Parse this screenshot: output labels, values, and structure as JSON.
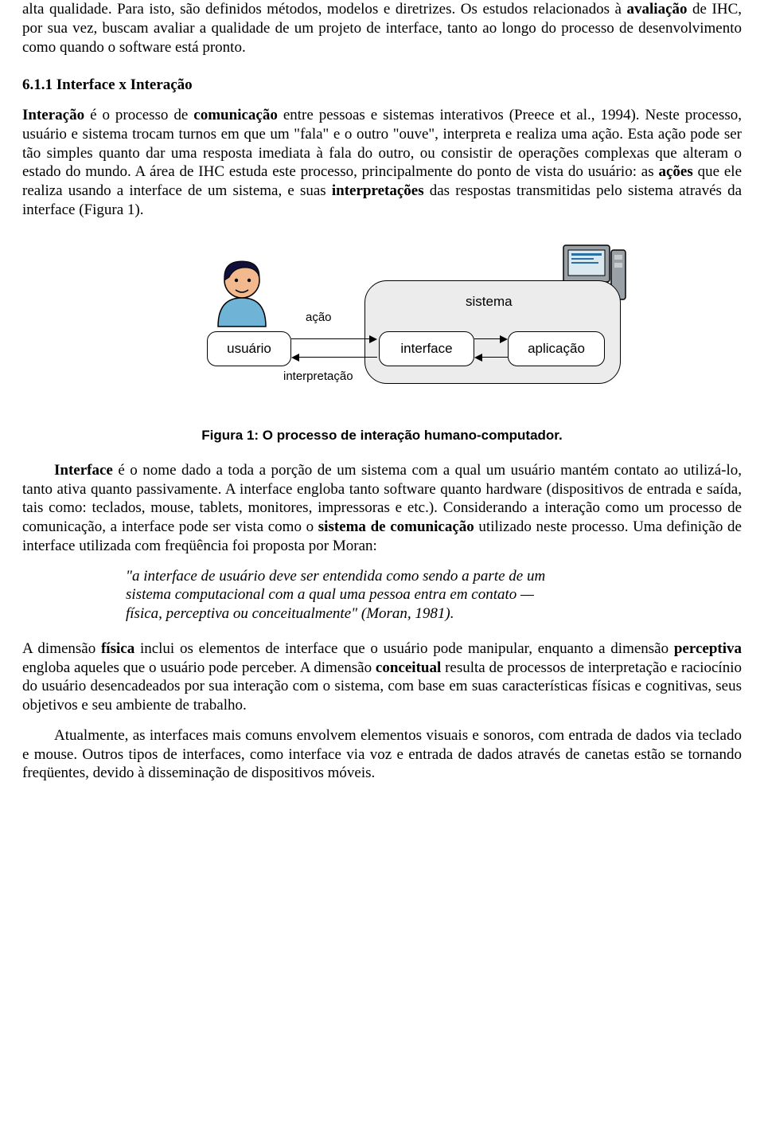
{
  "paragraphs": {
    "p1a": "alta qualidade. Para isto, são definidos métodos, modelos e diretrizes. Os estudos relacionados à ",
    "p1b": "avaliação",
    "p1c": " de IHC, por sua vez, buscam avaliar a qualidade de um projeto de interface, tanto ao longo do processo de desenvolvimento como quando o software está pronto.",
    "h1": "6.1.1 Interface x Interação",
    "p2a": "Interação",
    "p2b": " é o processo de ",
    "p2c": "comunicação",
    "p2d": " entre pessoas e sistemas interativos (Preece et al., 1994). Neste processo, usuário e sistema trocam turnos em que um \"fala\" e o outro \"ouve\", interpreta e realiza uma ação. Esta ação pode ser tão simples quanto dar uma resposta imediata à fala do outro, ou consistir de operações complexas que alteram o estado do mundo. A área de IHC estuda este processo, principalmente do ponto de vista do usuário: as ",
    "p2e": "ações",
    "p2f": " que ele realiza usando a interface de um sistema, e suas ",
    "p2g": "interpretações",
    "p2h": " das respostas transmitidas pelo sistema através da interface (Figura 1).",
    "caption": "Figura 1: O processo de interação humano-computador.",
    "p3a": "Interface",
    "p3b": " é o nome dado a toda a porção de um sistema com a qual um usuário mantém contato ao utilizá-lo, tanto ativa quanto passivamente. A interface engloba tanto software quanto hardware (dispositivos de entrada e saída, tais como: teclados, mouse, tablets, monitores, impressoras e etc.). Considerando a interação como um processo de comunicação, a interface pode ser vista como o ",
    "p3c": "sistema de comunicação",
    "p3d": " utilizado neste processo. Uma definição de interface utilizada com freqüência foi proposta por Moran:",
    "quote1": "\"a interface de usuário deve ser entendida como sendo a parte de um",
    "quote2": "sistema computacional com a qual uma pessoa entra em contato —",
    "quote3": "física, perceptiva ou conceitualmente\" (Moran, 1981).",
    "p4a": "A dimensão ",
    "p4b": "física",
    "p4c": " inclui os elementos de interface que o usuário pode manipular, enquanto a dimensão ",
    "p4d": "perceptiva",
    "p4e": " engloba aqueles que o usuário pode perceber. A dimensão ",
    "p4f": "conceitual",
    "p4g": " resulta de processos de interpretação e raciocínio do usuário desencadeados por sua interação com o sistema, com base em suas características físicas e cognitivas, seus objetivos e seu ambiente de trabalho.",
    "p5": "Atualmente, as interfaces mais comuns envolvem elementos visuais e sonoros, com entrada de dados via teclado e mouse. Outros tipos de interfaces, como interface via voz e entrada de dados através de canetas estão se tornando freqüentes, devido à disseminação de dispositivos móveis."
  },
  "diagram": {
    "usuario": "usuário",
    "acao": "ação",
    "interpretacao": "interpretação",
    "sistema": "sistema",
    "interface": "interface",
    "aplicacao": "aplicação"
  }
}
